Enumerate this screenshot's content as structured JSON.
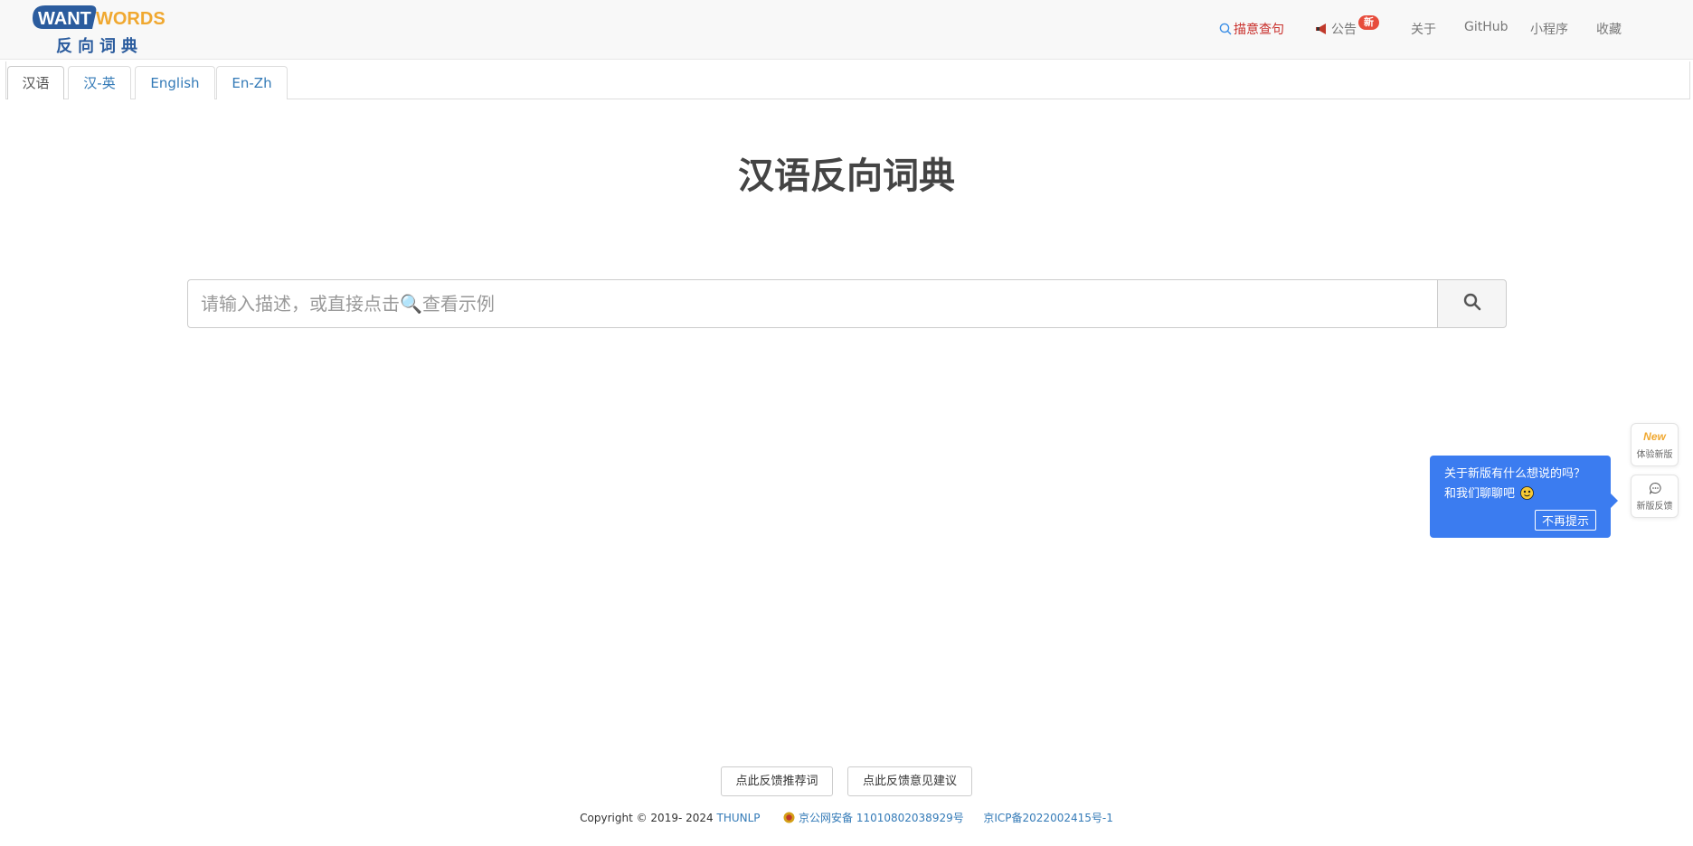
{
  "header": {
    "logo_top": "WANT",
    "logo_top2": "WORDS",
    "logo_bottom": "反向词典",
    "nav": [
      {
        "label": "描意查句",
        "icon": "search-icon"
      },
      {
        "label": "公告",
        "icon": "megaphone-icon",
        "badge": "新"
      },
      {
        "label": "关于"
      },
      {
        "label": "GitHub"
      },
      {
        "label": "小程序"
      },
      {
        "label": "收藏"
      }
    ]
  },
  "tabs": [
    {
      "label": "汉语",
      "active": true
    },
    {
      "label": "汉-英"
    },
    {
      "label": "English"
    },
    {
      "label": "En-Zh"
    }
  ],
  "main": {
    "title": "汉语反向词典",
    "search_placeholder": "请输入描述，或直接点击🔍查看示例"
  },
  "popover": {
    "line1": "关于新版有什么想说的吗？",
    "line2": "和我们聊聊吧",
    "dismiss": "不再提示"
  },
  "side": {
    "try_new_badge": "New",
    "try_new": "体验新版",
    "feedback": "新版反馈"
  },
  "footer": {
    "btn_words": "点此反馈推荐词",
    "btn_suggest": "点此反馈意见建议",
    "copyright": "Copyright © 2019- 2024",
    "org": "THUNLP",
    "police": "京公网安备 11010802038929号",
    "icp": "京ICP备2022002415号-1"
  },
  "colors": {
    "brand_blue": "#2b5c9e",
    "brand_orange": "#f0a830",
    "active_nav": "#c9302c",
    "popover_bg": "#3b7cf0",
    "link": "#337ab7"
  }
}
